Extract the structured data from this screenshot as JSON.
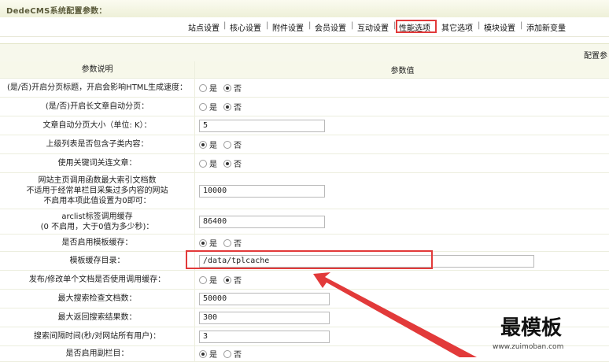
{
  "window": {
    "title": "DedeCMS系统配置参数："
  },
  "tabs": [
    {
      "label": "站点设置"
    },
    {
      "label": "核心设置"
    },
    {
      "label": "附件设置"
    },
    {
      "label": "会员设置"
    },
    {
      "label": "互动设置"
    },
    {
      "label": "性能选项"
    },
    {
      "label": "其它选项"
    },
    {
      "label": "模块设置"
    },
    {
      "label": "添加新变量"
    }
  ],
  "subbar": {
    "text": "配置参"
  },
  "table": {
    "header": {
      "desc": "参数说明",
      "value": "参数值"
    },
    "rows": [
      {
        "label": "(是/否)开启分页标题，开启会影响HTML生成速度：",
        "type": "radio",
        "options": [
          "是",
          "否"
        ],
        "selected": "否"
      },
      {
        "label": "(是/否)开启长文章自动分页：",
        "type": "radio",
        "options": [
          "是",
          "否"
        ],
        "selected": "否"
      },
      {
        "label": "文章自动分页大小（单位: K）：",
        "type": "input",
        "value": "5"
      },
      {
        "label": "上级列表是否包含子类内容：",
        "type": "radio",
        "options": [
          "是",
          "否"
        ],
        "selected": "是"
      },
      {
        "label": "使用关键词关连文章：",
        "type": "radio",
        "options": [
          "是",
          "否"
        ],
        "selected": "否"
      },
      {
        "label": "网站主页调用函数最大索引文档数\n不适用于经常单栏目采集过多内容的网站\n不启用本项此值设置为0即可：",
        "type": "input",
        "value": "10000"
      },
      {
        "label": "arclist标签调用缓存\n(0 不启用，大于0值为多少秒)：",
        "type": "input",
        "value": "86400"
      },
      {
        "label": "是否启用模板缓存：",
        "type": "radio",
        "options": [
          "是",
          "否"
        ],
        "selected": "是"
      },
      {
        "label": "模板缓存目录：",
        "type": "input",
        "value": "/data/tplcache"
      },
      {
        "label": "发布/修改单个文档是否使用调用缓存：",
        "type": "radio",
        "options": [
          "是",
          "否"
        ],
        "selected": "否"
      },
      {
        "label": "最大搜索检查文档数：",
        "type": "input",
        "value": "50000"
      },
      {
        "label": "最大返回搜索结果数：",
        "type": "input",
        "value": "300"
      },
      {
        "label": "搜索间隔时间(秒/对网站所有用户)：",
        "type": "input",
        "value": "3"
      },
      {
        "label": "是否启用副栏目：",
        "type": "radio",
        "options": [
          "是",
          "否"
        ],
        "selected": "是"
      }
    ]
  },
  "watermark": {
    "brand": "最模板",
    "url": "www.zuimoban.com"
  },
  "colors": {
    "highlight": "#e23a3a",
    "header_bg": "#f7f8ea"
  }
}
